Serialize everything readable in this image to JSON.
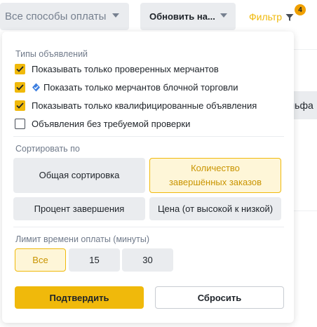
{
  "toolbar": {
    "payment_methods_label": "Все способы оплаты",
    "refresh_label": "Обновить на...",
    "filter_label": "Фильтр",
    "filter_badge_count": "4"
  },
  "background": {
    "partial_text": "льфа"
  },
  "filter_panel": {
    "ad_types_title": "Типы объявлений",
    "checkboxes": [
      {
        "label": "Показывать только проверенных мерчантов",
        "checked": true
      },
      {
        "label": "Показать только мерчантов блочной торговли",
        "checked": true,
        "icon": "verified-shield-icon"
      },
      {
        "label": "Показывать только квалифицированные объявления",
        "checked": true
      },
      {
        "label": "Объявления без требуемой проверки",
        "checked": false
      }
    ],
    "sort_title": "Сортировать по",
    "sort_options": [
      {
        "label": "Общая сортировка",
        "active": false
      },
      {
        "label": "Количество завершённых заказов",
        "active": true
      },
      {
        "label": "Процент завершения",
        "active": false
      },
      {
        "label": "Цена (от высокой к низкой)",
        "active": false
      }
    ],
    "time_limit_title": "Лимит времени оплаты (минуты)",
    "time_options": [
      {
        "label": "Все",
        "active": true
      },
      {
        "label": "15",
        "active": false
      },
      {
        "label": "30",
        "active": false
      }
    ],
    "confirm_label": "Подтвердить",
    "reset_label": "Сбросить"
  },
  "colors": {
    "accent": "#f0b90b",
    "accent_text": "#c99400",
    "neutral_bg": "#eaecef",
    "text": "#1e2329",
    "muted_text": "#707a8a"
  }
}
